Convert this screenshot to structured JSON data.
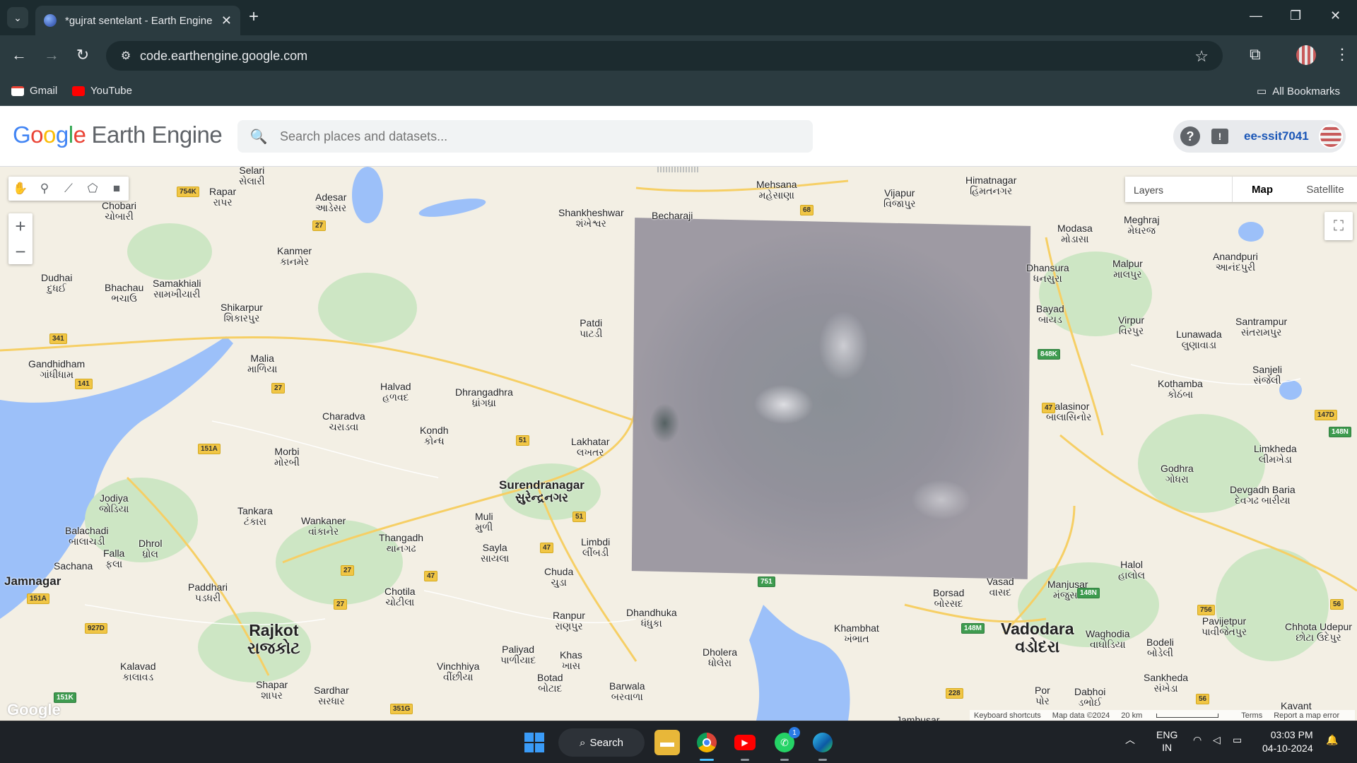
{
  "browser": {
    "tab_title": "*gujrat sentelant - Earth Engine",
    "url": "code.earthengine.google.com",
    "bookmarks": [
      {
        "label": "Gmail",
        "icon": "gmail-icon"
      },
      {
        "label": "YouTube",
        "icon": "youtube-icon"
      }
    ],
    "all_bookmarks": "All Bookmarks"
  },
  "gee": {
    "logo_google": "Google",
    "logo_product": "Earth Engine",
    "search_placeholder": "Search places and datasets...",
    "username": "ee-ssit7041"
  },
  "map": {
    "layers_label": "Layers",
    "map_type_map": "Map",
    "map_type_satellite": "Satellite",
    "footer": {
      "shortcuts": "Keyboard shortcuts",
      "map_data": "Map data ©2024",
      "scale": "20 km",
      "terms": "Terms",
      "report": "Report a map error"
    },
    "watermark": "Google",
    "cities": [
      {
        "name": "Selari",
        "local": "સેલારી"
      },
      {
        "name": "Rapar",
        "local": "રાપર"
      },
      {
        "name": "Chobari",
        "local": "ચોબારી"
      },
      {
        "name": "Adesar",
        "local": "આડેસર"
      },
      {
        "name": "Kanmer",
        "local": "કાનમેર"
      },
      {
        "name": "Dudhai",
        "local": "દુધઈ"
      },
      {
        "name": "Bhachau",
        "local": "ભચાઉ"
      },
      {
        "name": "Samakhiali",
        "local": "સામખીયારી"
      },
      {
        "name": "Shikarpur",
        "local": "શિકારપુર"
      },
      {
        "name": "Gandhidham",
        "local": "ગાંધીધામ"
      },
      {
        "name": "Malia",
        "local": "માળિયા"
      },
      {
        "name": "Halvad",
        "local": "હળવદ"
      },
      {
        "name": "Dhrangadhra",
        "local": "ધ્રાંગધ્રા"
      },
      {
        "name": "Charadva",
        "local": "ચરાડવા"
      },
      {
        "name": "Kondh",
        "local": "કોન્ધ"
      },
      {
        "name": "Morbi",
        "local": "મોરબી"
      },
      {
        "name": "Jodiya",
        "local": "જોડિયા"
      },
      {
        "name": "Tankara",
        "local": "ટંકારા"
      },
      {
        "name": "Wankaner",
        "local": "વાંકાનેર"
      },
      {
        "name": "Balachadi",
        "local": "બાલાચડી"
      },
      {
        "name": "Dhrol",
        "local": "ધ્રોલ"
      },
      {
        "name": "Falla",
        "local": "ફલા"
      },
      {
        "name": "Sachana",
        "local": "સચાણા"
      },
      {
        "name": "Jamnagar",
        "local": ""
      },
      {
        "name": "Paddhari",
        "local": "પડધરી"
      },
      {
        "name": "Rajkot",
        "local": "રાજકોટ"
      },
      {
        "name": "Kalavad",
        "local": "કાલાવડ"
      },
      {
        "name": "Shapar",
        "local": "શાપર"
      },
      {
        "name": "Sardhar",
        "local": "સરધાર"
      },
      {
        "name": "Thangadh",
        "local": "થાનગઢ"
      },
      {
        "name": "Chotila",
        "local": "ચોટીલા"
      },
      {
        "name": "Vinchhiya",
        "local": "વીંછીયા"
      },
      {
        "name": "Paliyad",
        "local": "પાળીયાદ"
      },
      {
        "name": "Khas",
        "local": "ખાસ"
      },
      {
        "name": "Botad",
        "local": "બોટાદ"
      },
      {
        "name": "Barwala",
        "local": "બરવાળા"
      },
      {
        "name": "Muli",
        "local": "મુળી"
      },
      {
        "name": "Sayla",
        "local": "સાયલા"
      },
      {
        "name": "Chuda",
        "local": "ચુડા"
      },
      {
        "name": "Ranpur",
        "local": "રાણપુર"
      },
      {
        "name": "Surendranagar",
        "local": "સુરેન્દ્રનગર"
      },
      {
        "name": "Limbdi",
        "local": "લીંબડી"
      },
      {
        "name": "Lakhatar",
        "local": "લખતર"
      },
      {
        "name": "Patdi",
        "local": "પાટડી"
      },
      {
        "name": "Shankheshwar",
        "local": "શંખેશ્વર"
      },
      {
        "name": "Becharaji",
        "local": "બેચરાજી"
      },
      {
        "name": "Mehsana",
        "local": "મહેસાણા"
      },
      {
        "name": "Vijapur",
        "local": "વિજાપુર"
      },
      {
        "name": "Himatnagar",
        "local": "હિંમતનગર"
      },
      {
        "name": "Modasa",
        "local": "મોડાસા"
      },
      {
        "name": "Meghraj",
        "local": "મેઘરજ"
      },
      {
        "name": "Dhansura",
        "local": "ધનસુરા"
      },
      {
        "name": "Malpur",
        "local": "માલપુર"
      },
      {
        "name": "Anandpuri",
        "local": "આનંદપુરી"
      },
      {
        "name": "Bayad",
        "local": "બાયડ"
      },
      {
        "name": "Virpur",
        "local": "વિરપુર"
      },
      {
        "name": "Lunawada",
        "local": "લુણાવાડા"
      },
      {
        "name": "Santrampur",
        "local": "સંતરામપુર"
      },
      {
        "name": "Kothamba",
        "local": "કોઠંબા"
      },
      {
        "name": "Sanjeli",
        "local": "સંજેલી"
      },
      {
        "name": "Balasinor",
        "local": "બાલાસિનોર"
      },
      {
        "name": "Limkheda",
        "local": "લીમખેડા"
      },
      {
        "name": "Godhra",
        "local": "ગોધરા"
      },
      {
        "name": "Devgadh Baria",
        "local": "દેવગઢ બારીયા"
      },
      {
        "name": "Halol",
        "local": "હાલોલ"
      },
      {
        "name": "Vasad",
        "local": "વાસદ"
      },
      {
        "name": "Manjusar",
        "local": "મંજુસર"
      },
      {
        "name": "Borsad",
        "local": "બોરસદ"
      },
      {
        "name": "Khambhat",
        "local": "ખંભાત"
      },
      {
        "name": "Vadodara",
        "local": "વડોદરા"
      },
      {
        "name": "Waghodia",
        "local": "વાઘોડિયા"
      },
      {
        "name": "Pavijetpur",
        "local": "પાવીજેતપુર"
      },
      {
        "name": "Chhota Udepur",
        "local": "છોટા ઉદેપુર"
      },
      {
        "name": "Bodeli",
        "local": "બોડેલી"
      },
      {
        "name": "Sankheda",
        "local": "સંખેડા"
      },
      {
        "name": "Dabhoi",
        "local": "ડભોઈ"
      },
      {
        "name": "Dhandhuka",
        "local": "ધંધુકા"
      },
      {
        "name": "Dholera",
        "local": "ધોલેરા"
      },
      {
        "name": "Jambusar",
        "local": ""
      },
      {
        "name": "Por",
        "local": "પોર"
      },
      {
        "name": "Kavant",
        "local": ""
      }
    ],
    "highways": [
      "754K",
      "27",
      "341",
      "141",
      "151A",
      "27",
      "51",
      "51",
      "47",
      "47",
      "27",
      "27",
      "68",
      "848K",
      "47",
      "147D",
      "148N",
      "148N",
      "148M",
      "228",
      "56",
      "56",
      "756",
      "751",
      "151K",
      "351G",
      "927D",
      "151A"
    ]
  },
  "taskbar": {
    "search_label": "Search",
    "lang_line1": "ENG",
    "lang_line2": "IN",
    "time": "03:03 PM",
    "date": "04-10-2024",
    "whatsapp_badge": "1"
  }
}
